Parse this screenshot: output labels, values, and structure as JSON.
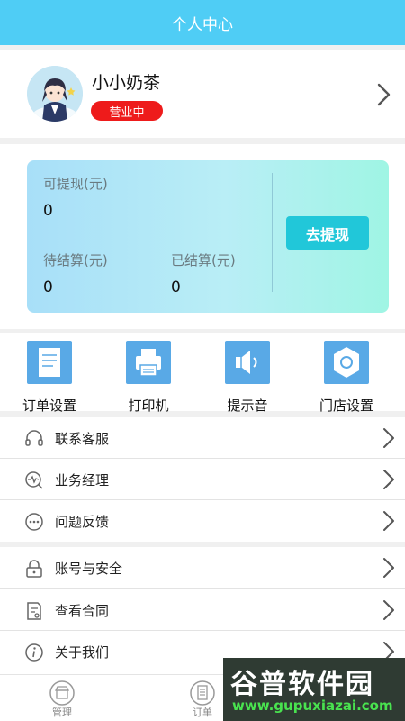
{
  "header": {
    "title": "个人中心"
  },
  "profile": {
    "shop_name": "小小奶茶",
    "status": "营业中"
  },
  "wallet": {
    "withdrawable_label": "可提现(元)",
    "withdrawable_value": "0",
    "pending_label": "待结算(元)",
    "pending_value": "0",
    "settled_label": "已结算(元)",
    "settled_value": "0",
    "withdraw_button": "去提现"
  },
  "quick_actions": [
    {
      "label": "订单设置",
      "icon": "order-settings-icon"
    },
    {
      "label": "打印机",
      "icon": "printer-icon"
    },
    {
      "label": "提示音",
      "icon": "speaker-icon"
    },
    {
      "label": "门店设置",
      "icon": "store-settings-icon"
    }
  ],
  "menu": [
    {
      "label": "联系客服",
      "icon": "headset-icon"
    },
    {
      "label": "业务经理",
      "icon": "manager-icon"
    },
    {
      "label": "问题反馈",
      "icon": "feedback-icon"
    },
    {
      "label": "账号与安全",
      "icon": "lock-icon"
    },
    {
      "label": "查看合同",
      "icon": "contract-icon"
    },
    {
      "label": "关于我们",
      "icon": "info-icon"
    }
  ],
  "tabbar": [
    {
      "label": "管理",
      "icon": "store-icon"
    },
    {
      "label": "订单",
      "icon": "order-list-icon"
    }
  ],
  "watermark": {
    "text": "谷普软件园",
    "url": "www.gupuxiazai.com"
  },
  "colors": {
    "header": "#4fcdf5",
    "status_badge": "#ee1b1b",
    "withdraw_button": "#21c7d9",
    "tile": "#59a9e6"
  }
}
